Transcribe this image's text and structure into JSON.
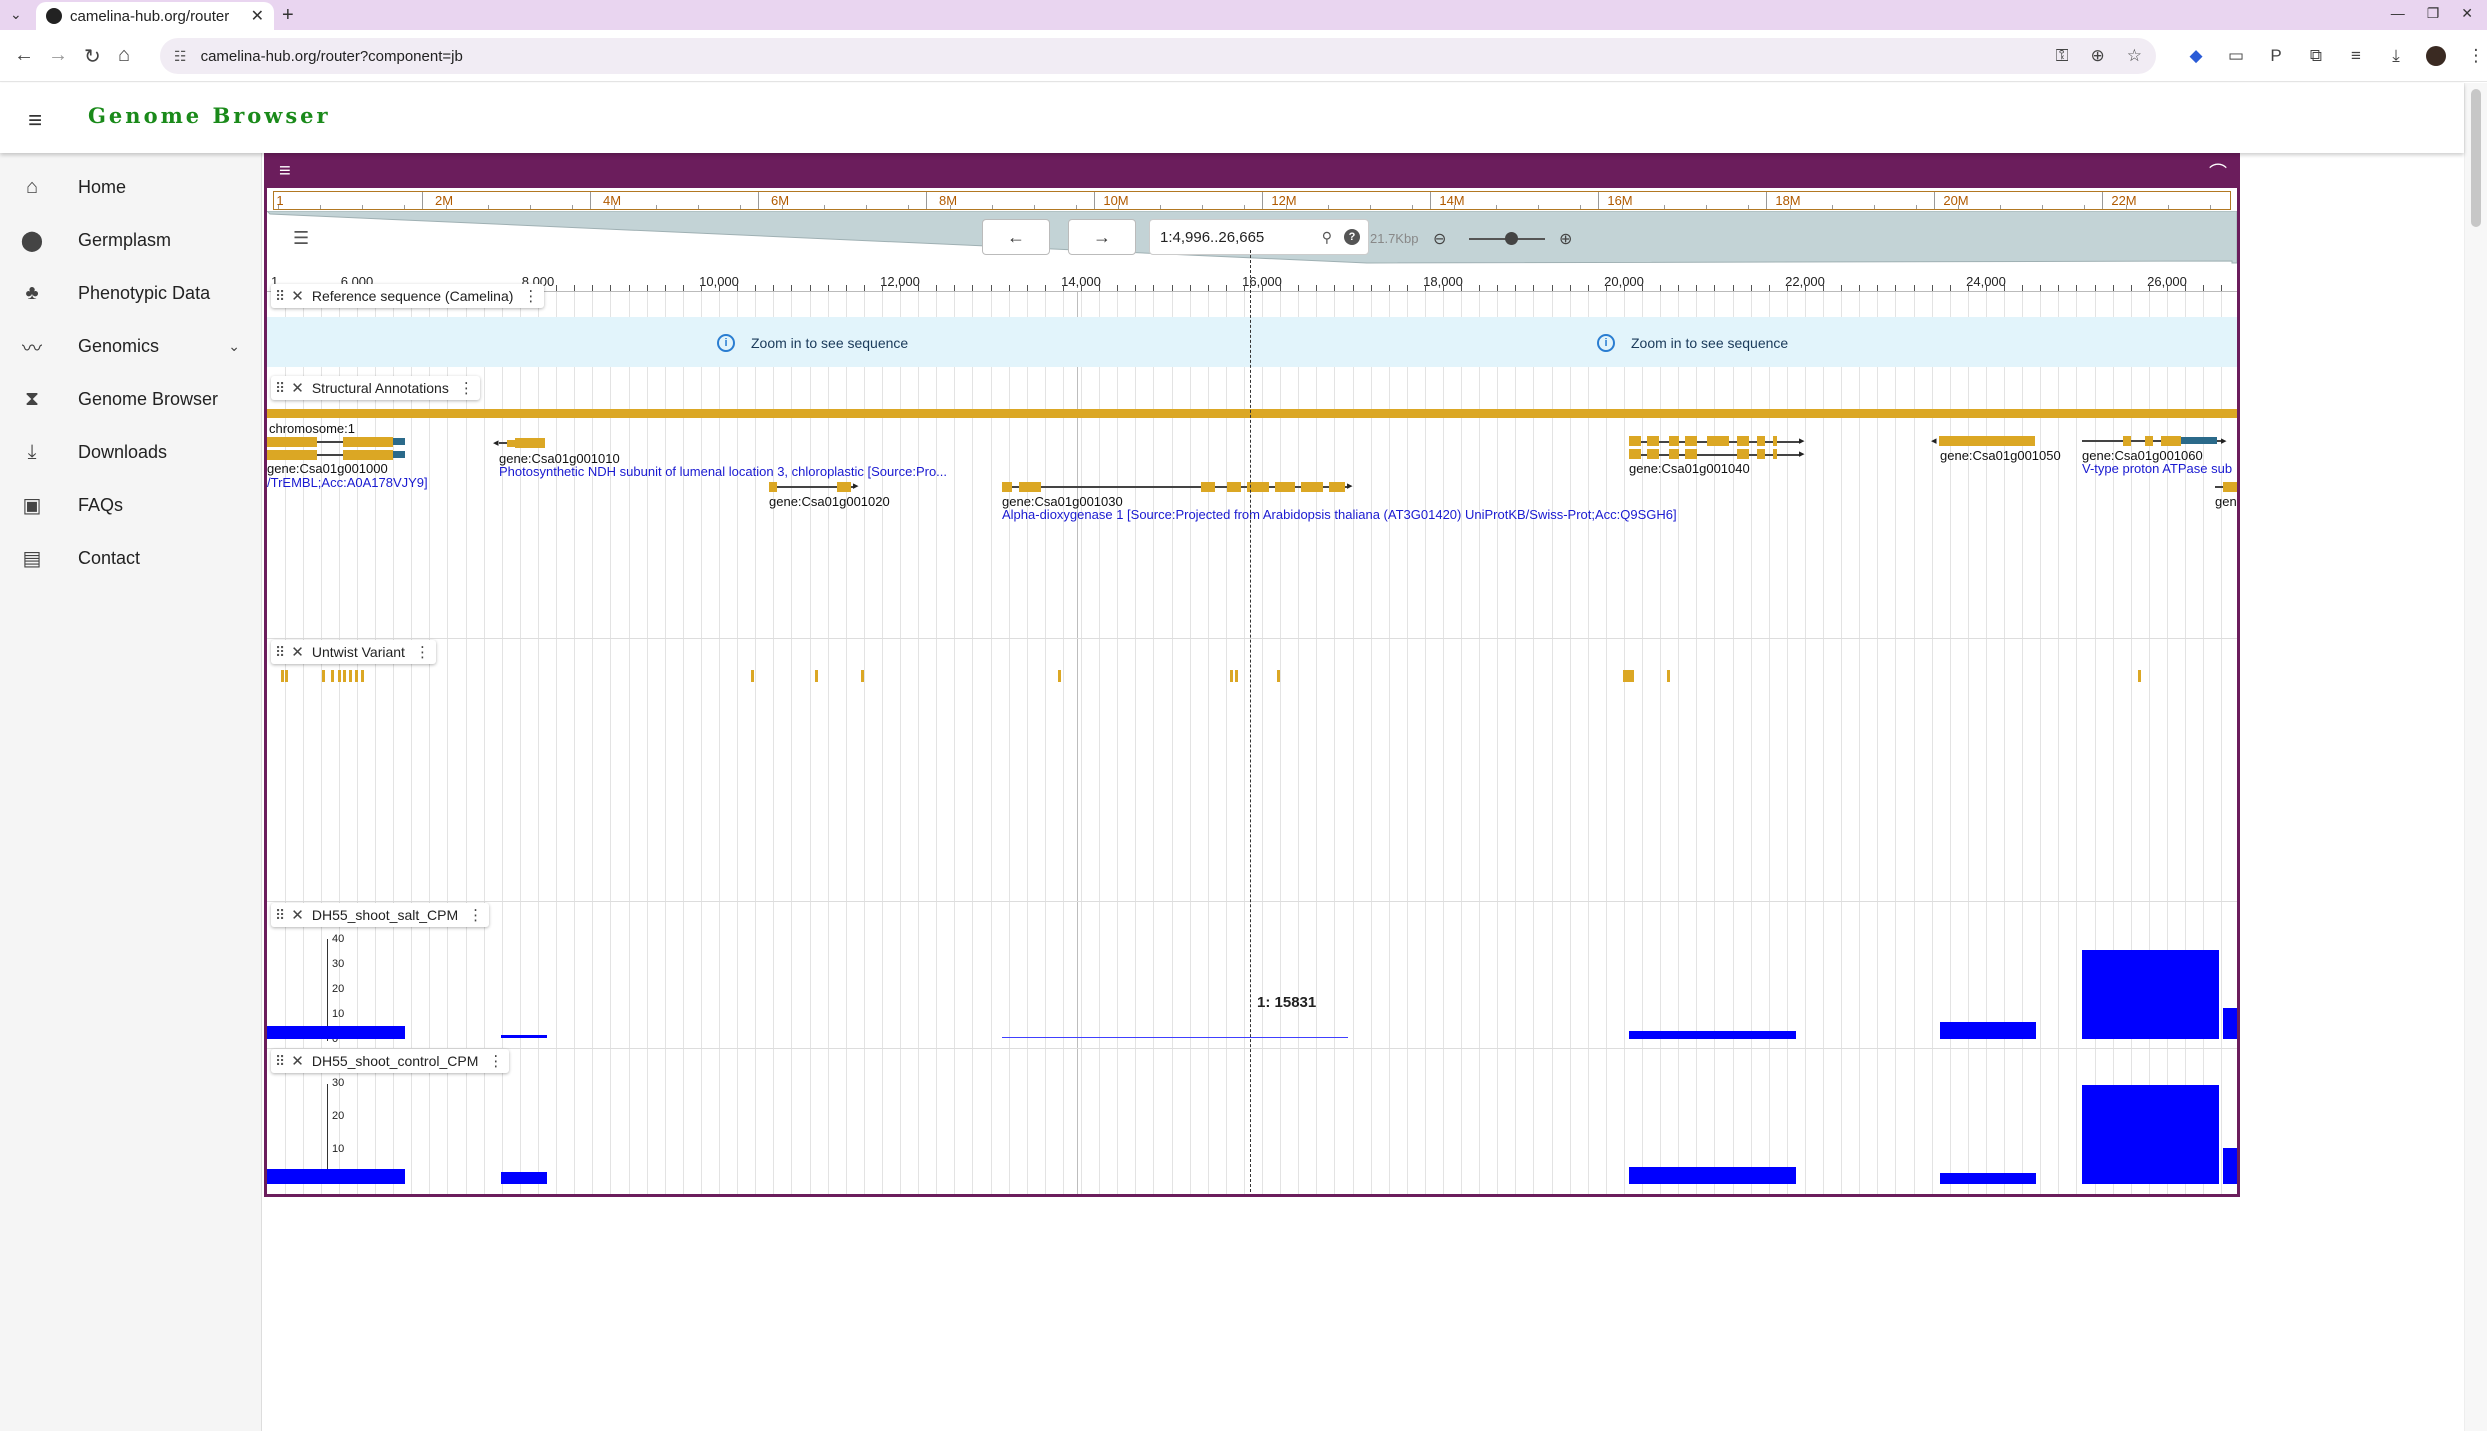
{
  "browser": {
    "tab_title": "camelina-hub.org/router",
    "url": "camelina-hub.org/router?component=jb"
  },
  "app": {
    "title": "Genome Browser"
  },
  "sidebar": {
    "items": [
      {
        "label": "Home",
        "icon": "home-icon"
      },
      {
        "label": "Germplasm",
        "icon": "location-pin-icon"
      },
      {
        "label": "Phenotypic Data",
        "icon": "trees-icon"
      },
      {
        "label": "Genomics",
        "icon": "trend-line-icon"
      },
      {
        "label": "Genome Browser",
        "icon": "hourglass-icon"
      },
      {
        "label": "Downloads",
        "icon": "download-icon"
      },
      {
        "label": "FAQs",
        "icon": "faq-book-icon"
      },
      {
        "label": "Contact",
        "icon": "contact-card-icon"
      }
    ]
  },
  "jbrowse": {
    "overview_labels": [
      "1",
      "2M",
      "4M",
      "6M",
      "8M",
      "10M",
      "12M",
      "14M",
      "16M",
      "18M",
      "20M",
      "22M"
    ],
    "location": "1:4,996..26,665",
    "bp_per_view": "21.7Kbp",
    "ruler_labels": [
      "1",
      "6,000",
      "8,000",
      "10,000",
      "12,000",
      "14,000",
      "16,000",
      "18,000",
      "20,000",
      "22,000",
      "24,000",
      "26,000"
    ],
    "tracks": {
      "reference": "Reference sequence (Camelina)",
      "structural": "Structural Annotations",
      "variant": "Untwist Variant",
      "salt": "DH55_shoot_salt_CPM",
      "control": "DH55_shoot_control_CPM"
    },
    "zoom_message": "Zoom in to see sequence",
    "chromosome_label": "chromosome:1",
    "genes": [
      {
        "name": "gene:Csa01g001000",
        "desc": "/TrEMBL;Acc:A0A178VJY9]"
      },
      {
        "name": "gene:Csa01g001010",
        "desc": "Photosynthetic NDH subunit of lumenal location 3, chloroplastic [Source:Pro..."
      },
      {
        "name": "gene:Csa01g001020",
        "desc": ""
      },
      {
        "name": "gene:Csa01g001030",
        "desc": "Alpha-dioxygenase 1 [Source:Projected from Arabidopsis thaliana (AT3G01420) UniProtKB/Swiss-Prot;Acc:Q9SGH6]"
      },
      {
        "name": "gene:Csa01g001040",
        "desc": ""
      },
      {
        "name": "gene:Csa01g001050",
        "desc": ""
      },
      {
        "name": "gene:Csa01g001060",
        "desc": "V-type proton ATPase sub"
      },
      {
        "name": "gen",
        "desc": ""
      }
    ],
    "salt_axis": [
      "40",
      "30",
      "20",
      "10",
      "0"
    ],
    "control_axis": [
      "30",
      "20",
      "10",
      "0"
    ],
    "cursor_position": "1: 15831"
  },
  "colors": {
    "brand": "#6b1d5c",
    "feature": "#dba724",
    "coverage": "#0000ff",
    "title_green": "#1a8a1a"
  }
}
